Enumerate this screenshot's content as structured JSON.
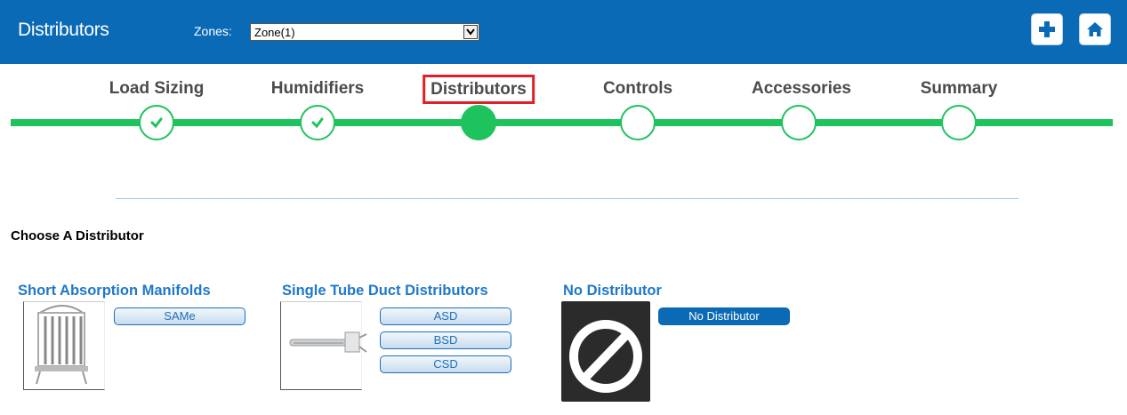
{
  "header": {
    "title": "Distributors",
    "zones_label": "Zones:",
    "zone_value": "Zone(1)",
    "add_icon": "plus-icon",
    "home_icon": "home-icon",
    "bg_color": "#0a6ab5"
  },
  "steps": [
    {
      "label": "Load Sizing",
      "state": "complete"
    },
    {
      "label": "Humidifiers",
      "state": "complete"
    },
    {
      "label": "Distributors",
      "state": "current"
    },
    {
      "label": "Controls",
      "state": "pending"
    },
    {
      "label": "Accessories",
      "state": "pending"
    },
    {
      "label": "Summary",
      "state": "pending"
    }
  ],
  "colors": {
    "progress": "#1fc35d",
    "active_outline": "#e01f26",
    "link": "#1f78c8"
  },
  "section_title": "Choose A Distributor",
  "categories": [
    {
      "title": "Short Absorption Manifolds",
      "options": [
        "SAMe"
      ]
    },
    {
      "title": "Single Tube Duct Distributors",
      "options": [
        "ASD",
        "BSD",
        "CSD"
      ]
    },
    {
      "title": "No Distributor",
      "options": [
        "No Distributor"
      ]
    }
  ]
}
